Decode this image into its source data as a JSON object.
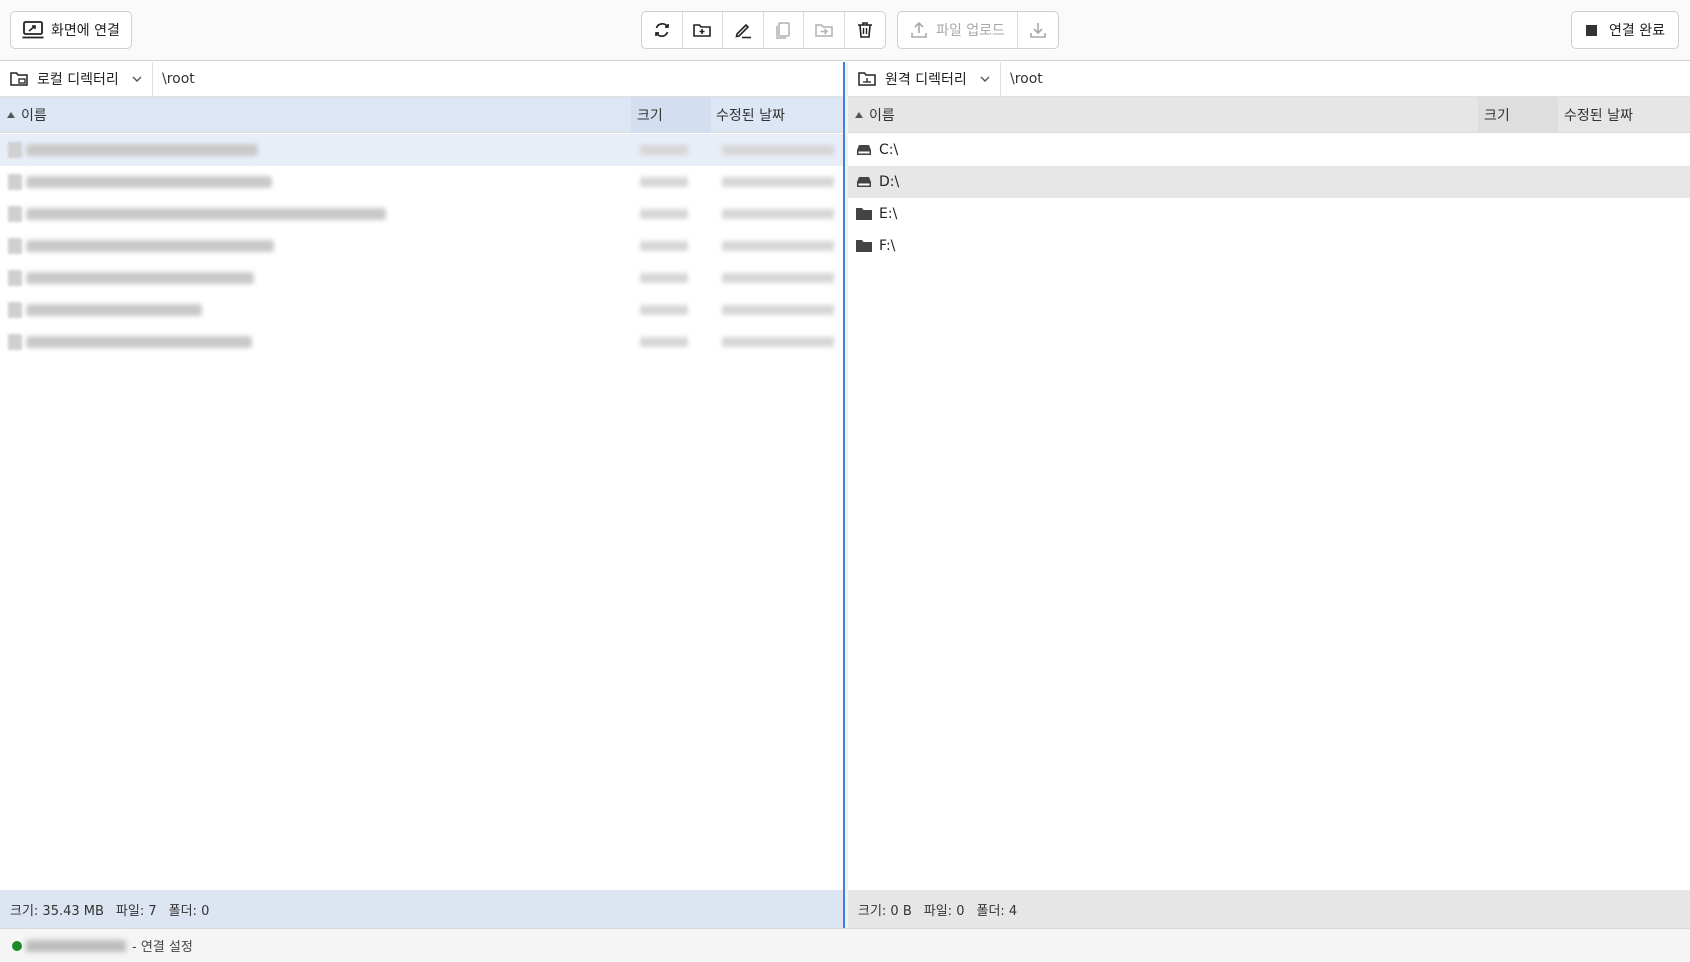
{
  "toolbar": {
    "connect_label": "화면에 연결",
    "upload_label": "파일 업로드",
    "done_label": "연결 완료",
    "tools": [
      "refresh-icon",
      "new-folder-icon",
      "rename-icon",
      "copy-icon",
      "move-icon",
      "delete-icon",
      "upload-icon",
      "download-icon"
    ]
  },
  "left": {
    "dir_label": "로컬 디렉터리",
    "path": "\\root",
    "col_name": "이름",
    "col_size": "크기",
    "col_date": "수정된 날짜",
    "status_size": "크기: 35.43 MB",
    "status_files": "파일: 7",
    "status_folders": "폴더: 0",
    "row_count": 7
  },
  "right": {
    "dir_label": "원격 디렉터리",
    "path": "\\root",
    "col_name": "이름",
    "col_size": "크기",
    "col_date": "수정된 날짜",
    "drives": [
      {
        "name": "C:\\",
        "icon": "drive-icon"
      },
      {
        "name": "D:\\",
        "icon": "drive-icon"
      },
      {
        "name": "E:\\",
        "icon": "folder-icon"
      },
      {
        "name": "F:\\",
        "icon": "folder-icon"
      }
    ],
    "status_size": "크기: 0 B",
    "status_files": "파일: 0",
    "status_folders": "폴더: 4"
  },
  "footer": {
    "suffix": "- 연결 설정"
  },
  "colors": {
    "accent": "#3d82d6",
    "status_ok": "#1a8a2a"
  }
}
